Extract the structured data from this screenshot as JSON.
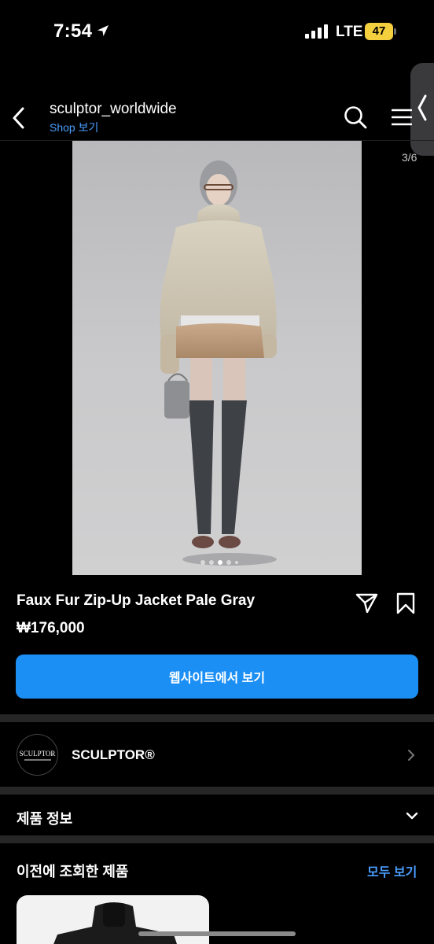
{
  "status_bar": {
    "time": "7:54",
    "network": "LTE",
    "battery": "47"
  },
  "header": {
    "account": "sculptor_worldwide",
    "shop_link": "Shop 보기"
  },
  "gallery": {
    "counter": "3/6",
    "total_images": 6,
    "current_index": 3
  },
  "product": {
    "name": "Faux Fur Zip-Up Jacket Pale Gray",
    "price": "₩176,000",
    "cta": "웹사이트에서 보기"
  },
  "brand": {
    "logo_text": "SCULPTOR",
    "name": "SCULPTOR®"
  },
  "product_info": {
    "label": "제품 정보"
  },
  "recent": {
    "title": "이전에 조회한 제품",
    "see_all": "모두 보기"
  },
  "colors": {
    "accent": "#1c8ff5",
    "link": "#4a9eff",
    "battery": "#f4d03f",
    "background": "#000000"
  }
}
